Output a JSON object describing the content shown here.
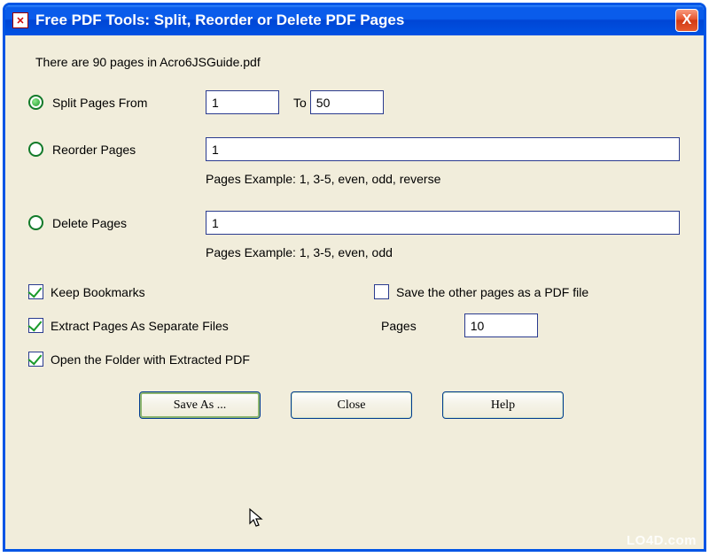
{
  "window": {
    "title": "Free PDF Tools: Split, Reorder or Delete PDF Pages",
    "close_icon": "X"
  },
  "info": "There are 90 pages in Acro6JSGuide.pdf",
  "options": {
    "split": {
      "label": "Split Pages From",
      "from_value": "1",
      "to_label": "To",
      "to_value": "50"
    },
    "reorder": {
      "label": "Reorder Pages",
      "value": "1",
      "hint": "Pages Example: 1, 3-5, even, odd, reverse"
    },
    "delete": {
      "label": "Delete Pages",
      "value": "1",
      "hint": "Pages Example: 1, 3-5, even, odd"
    }
  },
  "checks": {
    "keep_bookmarks": "Keep Bookmarks",
    "save_other": "Save the other pages as a PDF file",
    "extract_separate": "Extract Pages As Separate Files",
    "pages_label": "Pages",
    "pages_value": "10",
    "open_folder": "Open the Folder with Extracted PDF"
  },
  "buttons": {
    "save_as": "Save As ...",
    "close": "Close",
    "help": "Help"
  },
  "watermark": "LO4D.com"
}
